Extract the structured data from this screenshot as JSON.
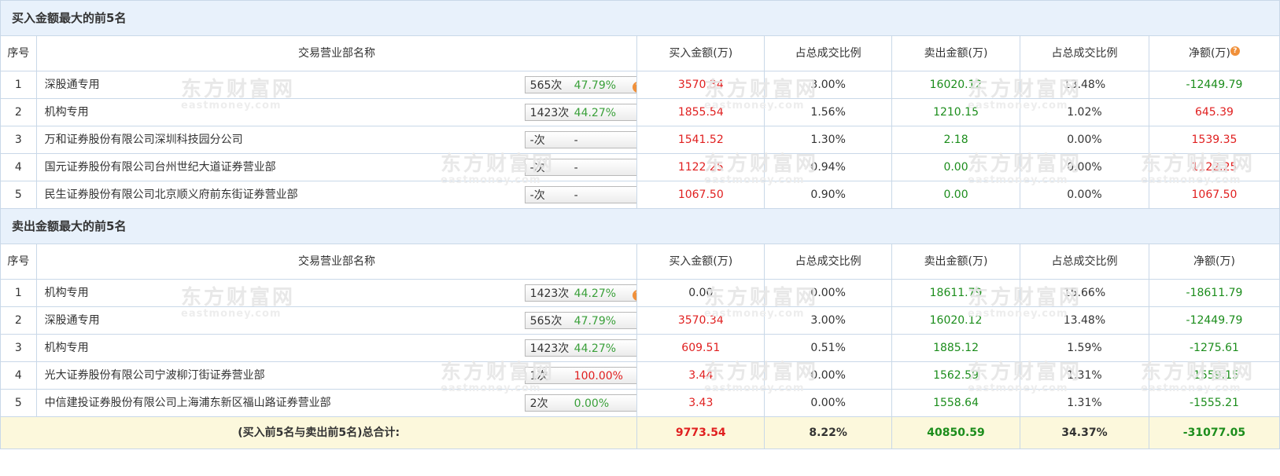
{
  "sections": {
    "buy_title": "买入金额最大的前5名",
    "sell_title": "卖出金额最大的前5名"
  },
  "headers": {
    "idx": "序号",
    "name": "交易营业部名称",
    "buy": "买入金额(万)",
    "buy_pct": "占总成交比例",
    "sell": "卖出金额(万)",
    "sell_pct": "占总成交比例",
    "net": "净额(万)"
  },
  "watermark": {
    "cn": "东方财富网",
    "en": "eastmoney.com"
  },
  "buy_rows": [
    {
      "idx": "1",
      "name": "深股通专用",
      "count": "565次",
      "pct": "47.79%",
      "pct_color": "green",
      "icon": "help-icon",
      "buy": "3570.34",
      "buy_pct": "3.00%",
      "sell": "16020.12",
      "sell_pct": "13.48%",
      "net": "-12449.79",
      "net_color": "green"
    },
    {
      "idx": "2",
      "name": "机构专用",
      "count": "1423次",
      "pct": "44.27%",
      "pct_color": "green",
      "icon": "arrow-right-icon",
      "buy": "1855.54",
      "buy_pct": "1.56%",
      "sell": "1210.15",
      "sell_pct": "1.02%",
      "net": "645.39",
      "net_color": "red"
    },
    {
      "idx": "3",
      "name": "万和证券股份有限公司深圳科技园分公司",
      "count": "-次",
      "pct": "-",
      "pct_color": "dark",
      "icon": "arrow-right-icon",
      "buy": "1541.52",
      "buy_pct": "1.30%",
      "sell": "2.18",
      "sell_pct": "0.00%",
      "net": "1539.35",
      "net_color": "red"
    },
    {
      "idx": "4",
      "name": "国元证券股份有限公司台州世纪大道证券营业部",
      "count": "-次",
      "pct": "-",
      "pct_color": "dark",
      "icon": "arrow-right-icon",
      "buy": "1122.25",
      "buy_pct": "0.94%",
      "sell": "0.00",
      "sell_pct": "0.00%",
      "net": "1122.25",
      "net_color": "red"
    },
    {
      "idx": "5",
      "name": "民生证券股份有限公司北京顺义府前东街证券营业部",
      "count": "-次",
      "pct": "-",
      "pct_color": "dark",
      "icon": "arrow-right-icon",
      "buy": "1067.50",
      "buy_pct": "0.90%",
      "sell": "0.00",
      "sell_pct": "0.00%",
      "net": "1067.50",
      "net_color": "red"
    }
  ],
  "sell_rows": [
    {
      "idx": "1",
      "name": "机构专用",
      "count": "1423次",
      "pct": "44.27%",
      "pct_color": "green",
      "icon": "help-icon",
      "buy": "0.00",
      "buy_color": "dark",
      "buy_pct": "0.00%",
      "sell": "18611.79",
      "sell_pct": "15.66%",
      "net": "-18611.79",
      "net_color": "green"
    },
    {
      "idx": "2",
      "name": "深股通专用",
      "count": "565次",
      "pct": "47.79%",
      "pct_color": "green",
      "icon": "arrow-right-icon",
      "buy": "3570.34",
      "buy_color": "red",
      "buy_pct": "3.00%",
      "sell": "16020.12",
      "sell_pct": "13.48%",
      "net": "-12449.79",
      "net_color": "green"
    },
    {
      "idx": "3",
      "name": "机构专用",
      "count": "1423次",
      "pct": "44.27%",
      "pct_color": "green",
      "icon": "arrow-right-icon",
      "buy": "609.51",
      "buy_color": "red",
      "buy_pct": "0.51%",
      "sell": "1885.12",
      "sell_pct": "1.59%",
      "net": "-1275.61",
      "net_color": "green"
    },
    {
      "idx": "4",
      "name": "光大证券股份有限公司宁波柳汀街证券营业部",
      "count": "1次",
      "pct": "100.00%",
      "pct_color": "red",
      "icon": "arrow-right-icon",
      "buy": "3.44",
      "buy_color": "red",
      "buy_pct": "0.00%",
      "sell": "1562.59",
      "sell_pct": "1.31%",
      "net": "-1559.15",
      "net_color": "green"
    },
    {
      "idx": "5",
      "name": "中信建投证券股份有限公司上海浦东新区福山路证券营业部",
      "count": "2次",
      "pct": "0.00%",
      "pct_color": "green",
      "icon": "arrow-right-icon",
      "buy": "3.43",
      "buy_color": "red",
      "buy_pct": "0.00%",
      "sell": "1558.64",
      "sell_pct": "1.31%",
      "net": "-1555.21",
      "net_color": "green"
    }
  ],
  "total": {
    "label": "(买入前5名与卖出前5名)总合计:",
    "buy": "9773.54",
    "buy_pct": "8.22%",
    "sell": "40850.59",
    "sell_pct": "34.37%",
    "net": "-31077.05"
  },
  "colors": {
    "red": "#e02020",
    "green": "#1c8d1c",
    "header_bg": "#e8f1fb",
    "total_bg": "#fcf8dc",
    "border": "#c9d8e8",
    "help": "#f0903a",
    "arrow": "#1a4e8a"
  },
  "help_glyph": "?"
}
